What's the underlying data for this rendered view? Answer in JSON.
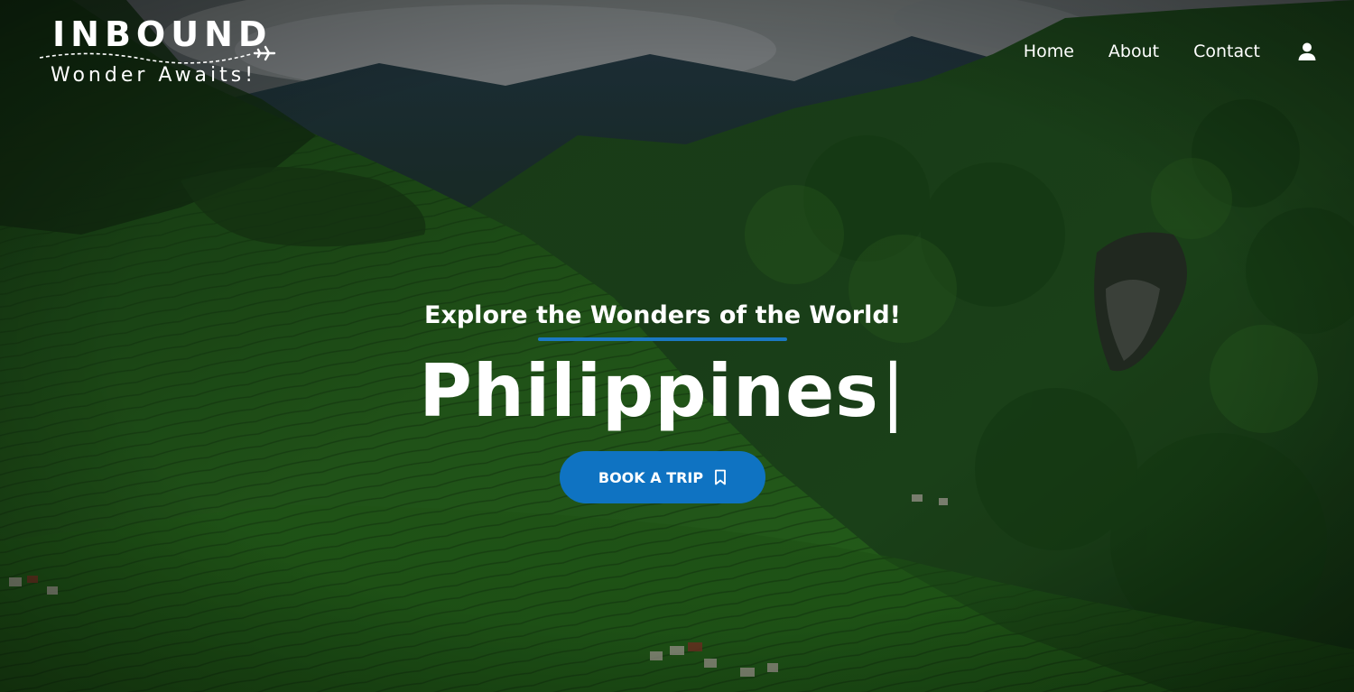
{
  "logo": {
    "title": "INBOUND",
    "tagline": "Wonder Awaits!"
  },
  "nav": {
    "items": [
      {
        "label": "Home"
      },
      {
        "label": "About"
      },
      {
        "label": "Contact"
      }
    ],
    "account_icon": "user-icon"
  },
  "hero": {
    "tagline": "Explore the Wonders of the World!",
    "destination": "Philippines",
    "cursor": "|",
    "button_label": "BOOK A TRIP",
    "button_icon": "bookmark-icon",
    "background": "rice terraces mountain landscape"
  },
  "colors": {
    "accent": "#0f73c2",
    "underline": "#1b78c2",
    "text": "#ffffff"
  }
}
